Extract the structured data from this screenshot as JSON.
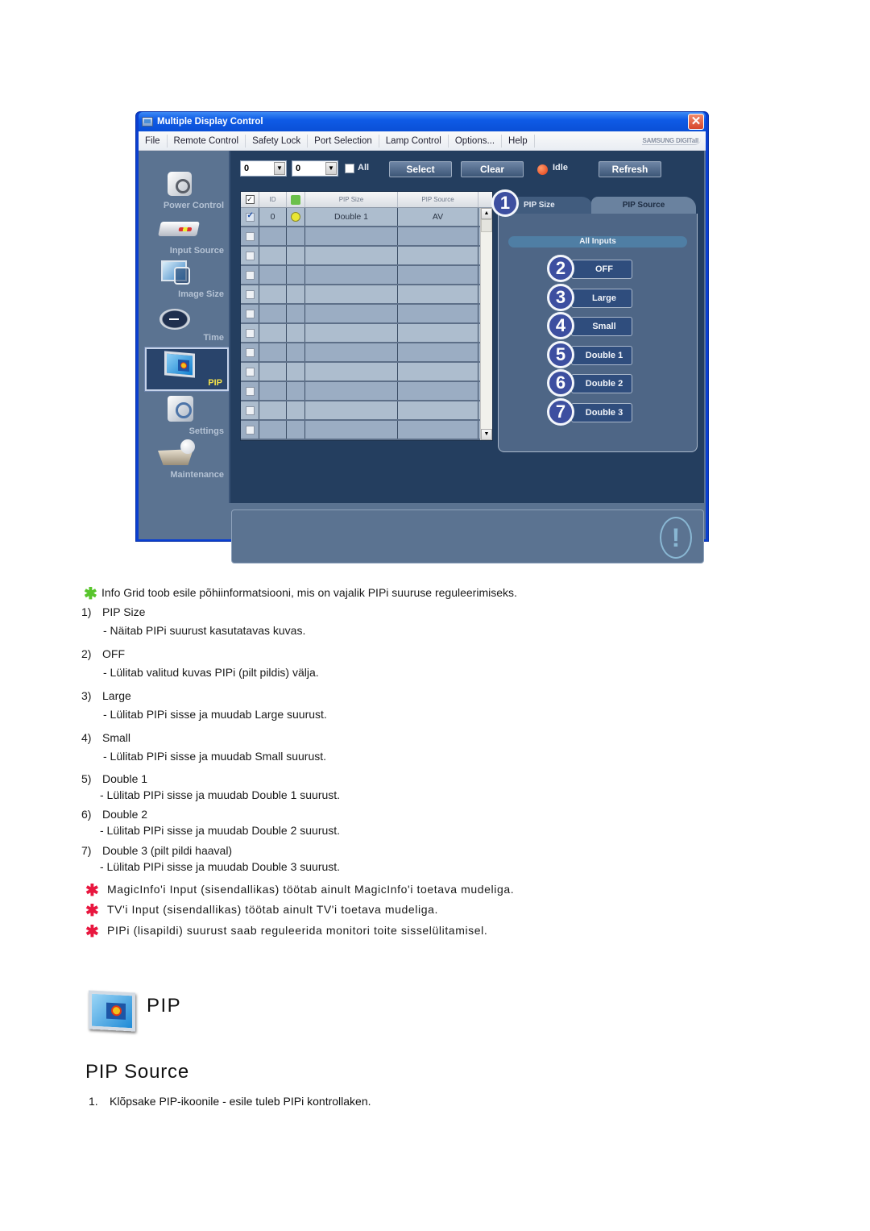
{
  "window": {
    "title": "Multiple Display Control",
    "close_glyph": "✕",
    "brand": "SAMSUNG DIGITall",
    "menu": [
      "File",
      "Remote Control",
      "Safety Lock",
      "Port Selection",
      "Lamp Control",
      "Options...",
      "Help"
    ]
  },
  "sidebar": {
    "items": [
      {
        "label": "Power Control",
        "icon": "power-control-icon",
        "active": false
      },
      {
        "label": "Input Source",
        "icon": "input-source-icon",
        "active": false
      },
      {
        "label": "Image Size",
        "icon": "image-size-icon",
        "active": false
      },
      {
        "label": "Time",
        "icon": "clock-icon",
        "active": false
      },
      {
        "label": "PIP",
        "icon": "pip-icon",
        "active": true
      },
      {
        "label": "Settings",
        "icon": "settings-icon",
        "active": false
      },
      {
        "label": "Maintenance",
        "icon": "maintenance-icon",
        "active": false
      }
    ]
  },
  "toolbar": {
    "from_id": "0",
    "to_id": "0",
    "all_label": "All",
    "all_checked": false,
    "select_label": "Select",
    "clear_label": "Clear",
    "status_label": "Idle",
    "status_color": "#e03b14",
    "refresh_label": "Refresh"
  },
  "grid": {
    "columns": [
      "",
      "ID",
      "",
      "PIP Size",
      "PIP Source"
    ],
    "rows": [
      {
        "checked": true,
        "id": "0",
        "power": "on",
        "pip_size": "Double 1",
        "pip_source": "AV"
      },
      {
        "checked": false,
        "id": "",
        "power": "",
        "pip_size": "",
        "pip_source": ""
      },
      {
        "checked": false,
        "id": "",
        "power": "",
        "pip_size": "",
        "pip_source": ""
      },
      {
        "checked": false,
        "id": "",
        "power": "",
        "pip_size": "",
        "pip_source": ""
      },
      {
        "checked": false,
        "id": "",
        "power": "",
        "pip_size": "",
        "pip_source": ""
      },
      {
        "checked": false,
        "id": "",
        "power": "",
        "pip_size": "",
        "pip_source": ""
      },
      {
        "checked": false,
        "id": "",
        "power": "",
        "pip_size": "",
        "pip_source": ""
      },
      {
        "checked": false,
        "id": "",
        "power": "",
        "pip_size": "",
        "pip_source": ""
      },
      {
        "checked": false,
        "id": "",
        "power": "",
        "pip_size": "",
        "pip_source": ""
      },
      {
        "checked": false,
        "id": "",
        "power": "",
        "pip_size": "",
        "pip_source": ""
      },
      {
        "checked": false,
        "id": "",
        "power": "",
        "pip_size": "",
        "pip_source": ""
      },
      {
        "checked": false,
        "id": "",
        "power": "",
        "pip_size": "",
        "pip_source": ""
      }
    ]
  },
  "tabs": {
    "active": {
      "label": "PIP Size",
      "badge": "1"
    },
    "inactive": {
      "label": "PIP Source"
    }
  },
  "pip_panel": {
    "section_label": "All Inputs",
    "buttons": [
      {
        "badge": "2",
        "label": "OFF"
      },
      {
        "badge": "3",
        "label": "Large"
      },
      {
        "badge": "4",
        "label": "Small"
      },
      {
        "badge": "5",
        "label": "Double 1"
      },
      {
        "badge": "6",
        "label": "Double 2"
      },
      {
        "badge": "7",
        "label": "Double 3"
      }
    ]
  },
  "message_panel": {
    "icon": "exclamation-icon",
    "glyph": "!"
  },
  "doc": {
    "intro": "Info Grid toob esile põhiinformatsiooni, mis on vajalik PIPi suuruse reguleerimiseks.",
    "items": [
      {
        "num": "1)",
        "title": "PIP Size",
        "desc": "- Näitab PIPi suurust kasutatavas kuvas."
      },
      {
        "num": "2)",
        "title": "OFF",
        "desc": "- Lülitab valitud kuvas PIPi (pilt pildis) välja."
      },
      {
        "num": "3)",
        "title": "Large",
        "desc": "- Lülitab PIPi sisse ja muudab Large suurust."
      },
      {
        "num": "4)",
        "title": "Small",
        "desc": "- Lülitab PIPi sisse ja muudab Small suurust."
      },
      {
        "num": "5)",
        "title": "Double 1",
        "desc": "- Lülitab PIPi sisse ja muudab Double 1 suurust."
      },
      {
        "num": "6)",
        "title": "Double 2",
        "desc": "- Lülitab PIPi sisse ja muudab Double 2 suurust."
      },
      {
        "num": "7)",
        "title": "Double 3 (pilt pildi haaval)",
        "desc": "- Lülitab PIPi sisse ja muudab Double 3 suurust."
      }
    ],
    "notes": [
      "MagicInfo'i Input (sisendallikas) töötab ainult MagicInfo'i toetava mudeliga.",
      "TV'i Input (sisendallikas) töötab ainult TV'i toetava mudeliga.",
      "PIPi (lisapildi) suurust saab reguleerida monitori toite sisselülitamisel."
    ],
    "star_glyph": "✱",
    "heading": "PIP",
    "subheading": "PIP Source",
    "steps": [
      {
        "num": "1.",
        "text": "Klõpsake PIP-ikoonile - esile tuleb PIPi kontrollaken."
      }
    ]
  },
  "colors": {
    "accent_green_star": "#58c52c",
    "accent_red_star": "#e8173f",
    "window_blue": "#0a3fd0",
    "active_nav_label": "#f2e14b"
  }
}
